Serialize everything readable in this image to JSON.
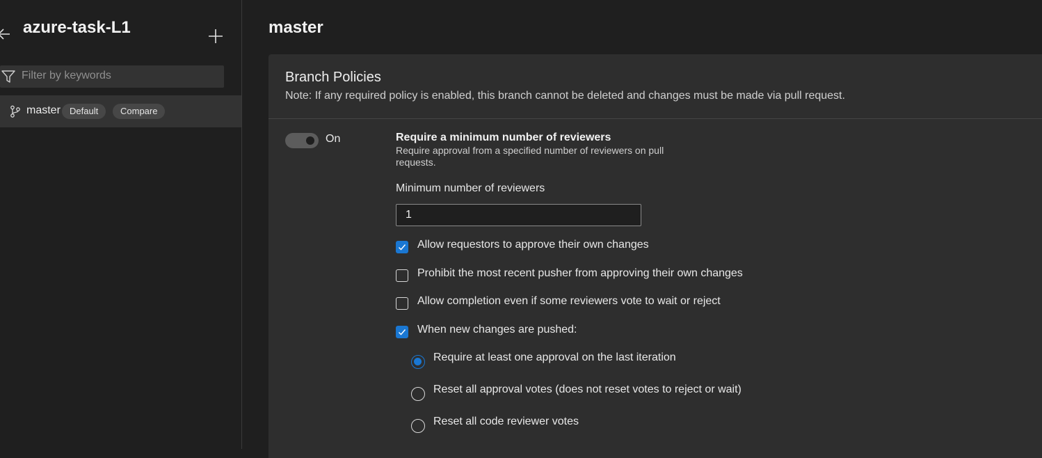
{
  "sidebar": {
    "repo_title": "azure-task-L1",
    "filter_placeholder": "Filter by keywords",
    "branches": [
      {
        "name": "master",
        "badge": "Default",
        "action": "Compare"
      }
    ]
  },
  "main": {
    "title": "master",
    "section_title": "Branch Policies",
    "note": "Note: If any required policy is enabled, this branch cannot be deleted and changes must be made via pull request.",
    "policy": {
      "toggle_label": "On",
      "toggle_on": true,
      "title": "Require a minimum number of reviewers",
      "description": "Require approval from a specified number of reviewers on pull requests.",
      "min_label": "Minimum number of reviewers",
      "min_value": "1",
      "checkboxes": [
        {
          "label": "Allow requestors to approve their own changes",
          "checked": true
        },
        {
          "label": "Prohibit the most recent pusher from approving their own changes",
          "checked": false
        },
        {
          "label": "Allow completion even if some reviewers vote to wait or reject",
          "checked": false
        },
        {
          "label": "When new changes are pushed:",
          "checked": true
        }
      ],
      "radios": [
        {
          "label": "Require at least one approval on the last iteration",
          "selected": true
        },
        {
          "label": "Reset all approval votes (does not reset votes to reject or wait)",
          "selected": false
        },
        {
          "label": "Reset all code reviewer votes",
          "selected": false
        }
      ]
    }
  },
  "colors": {
    "accent": "#1a77d2",
    "background": "#1f1f1f",
    "card": "#2e2e2e",
    "selected_row": "#333333"
  }
}
